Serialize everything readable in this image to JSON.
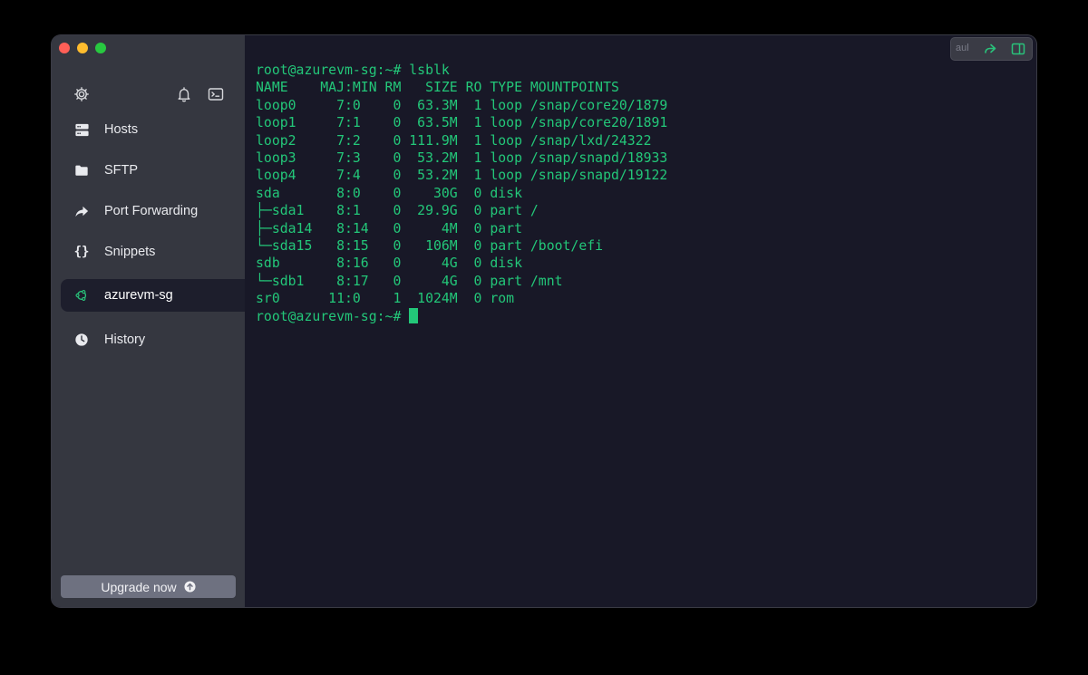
{
  "window": {
    "traffic_lights": [
      "close",
      "minimize",
      "zoom"
    ]
  },
  "sidebar": {
    "top_icons": [
      "gear-icon",
      "bell-icon",
      "terminal-icon"
    ],
    "items": [
      {
        "label": "Hosts",
        "icon": "hosts-icon"
      },
      {
        "label": "SFTP",
        "icon": "folder-icon"
      },
      {
        "label": "Port Forwarding",
        "icon": "forward-icon"
      },
      {
        "label": "Snippets",
        "icon": "braces-icon"
      },
      {
        "label": "azurevm-sg",
        "icon": "ubuntu-icon",
        "active": true
      },
      {
        "label": "History",
        "icon": "clock-icon"
      }
    ],
    "upgrade_label": "Upgrade now"
  },
  "terminal": {
    "top_controls_text": "aul",
    "lines": [
      "root@azurevm-sg:~# lsblk",
      "NAME    MAJ:MIN RM   SIZE RO TYPE MOUNTPOINTS",
      "loop0     7:0    0  63.3M  1 loop /snap/core20/1879",
      "loop1     7:1    0  63.5M  1 loop /snap/core20/1891",
      "loop2     7:2    0 111.9M  1 loop /snap/lxd/24322",
      "loop3     7:3    0  53.2M  1 loop /snap/snapd/18933",
      "loop4     7:4    0  53.2M  1 loop /snap/snapd/19122",
      "sda       8:0    0    30G  0 disk",
      "├─sda1    8:1    0  29.9G  0 part /",
      "├─sda14   8:14   0     4M  0 part",
      "└─sda15   8:15   0   106M  0 part /boot/efi",
      "sdb       8:16   0     4G  0 disk",
      "└─sdb1    8:17   0     4G  0 part /mnt",
      "sr0      11:0    1  1024M  0 rom"
    ],
    "prompt": "root@azurevm-sg:~# ",
    "accent_color": "#23c779"
  }
}
